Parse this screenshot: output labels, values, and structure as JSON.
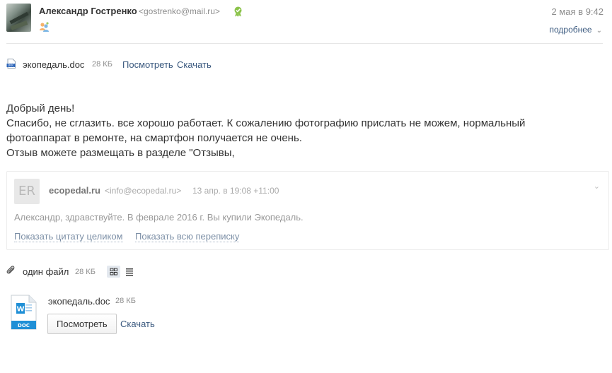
{
  "header": {
    "sender_name": "Александр Гостренко",
    "sender_email": "<gostrenko@mail.ru>",
    "date": "2 мая в 9:42",
    "details_label": "подробнее",
    "verified_icon": "verified-ribbon-icon",
    "contact_icon": "contact-persons-icon"
  },
  "top_attachment": {
    "name": "экопедаль.doc",
    "size": "28 КБ",
    "view_label": "Посмотреть",
    "download_label": "Скачать"
  },
  "body": {
    "lines": [
      "Добрый день!",
      "Спасибо, не сглазить. все хорошо работает. К сожалению фотографию прислать не можем, нормальный",
      "фотоаппарат в ремонте, на смартфон получается не очень.",
      "Отзыв можете размещать в разделе \"Отзывы,"
    ]
  },
  "quote": {
    "avatar_text": "ER",
    "sender_name": "ecopedal.ru",
    "sender_email": "<info@ecopedal.ru>",
    "date": "13 апр. в 19:08 +11:00",
    "text": "Александр, здравствуйте. В феврале 2016 г. Вы купили Экопедаль.",
    "show_full_label": "Показать цитату целиком",
    "show_thread_label": "Показать всю переписку"
  },
  "attachments": {
    "label": "один файл",
    "total_size": "28 КБ",
    "items": [
      {
        "name": "экопедаль.doc",
        "size": "28 КБ",
        "icon_label": "DOC",
        "view_label": "Посмотреть",
        "download_label": "Скачать"
      }
    ]
  },
  "colors": {
    "link": "#39587e",
    "muted": "#8c8c8c",
    "doc_blue": "#1f8fd6",
    "verified_green": "#8bc34a"
  }
}
